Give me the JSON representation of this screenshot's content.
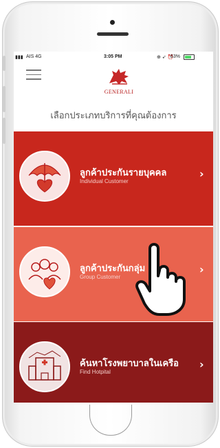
{
  "status_bar": {
    "carrier": "AIS 4G",
    "time": "3:05 PM",
    "battery": "63%"
  },
  "header": {
    "logo_text": "GENERALI"
  },
  "prompt": "เลือกประเภทบริการที่คุณต้องการ",
  "menu": [
    {
      "title": "ลูกค้าประกันรายบุคคล",
      "subtitle": "Individual Customer",
      "icon": "umbrella-heart-icon",
      "color": "#c8271d"
    },
    {
      "title": "ลูกค้าประกันกลุ่ม",
      "subtitle": "Group Customer",
      "icon": "group-heart-icon",
      "color": "#e9634e"
    },
    {
      "title": "ค้นหาโรงพยาบาลในเครือ",
      "subtitle": "Find Hotpital",
      "icon": "hospital-icon",
      "color": "#8b1a1a"
    }
  ]
}
